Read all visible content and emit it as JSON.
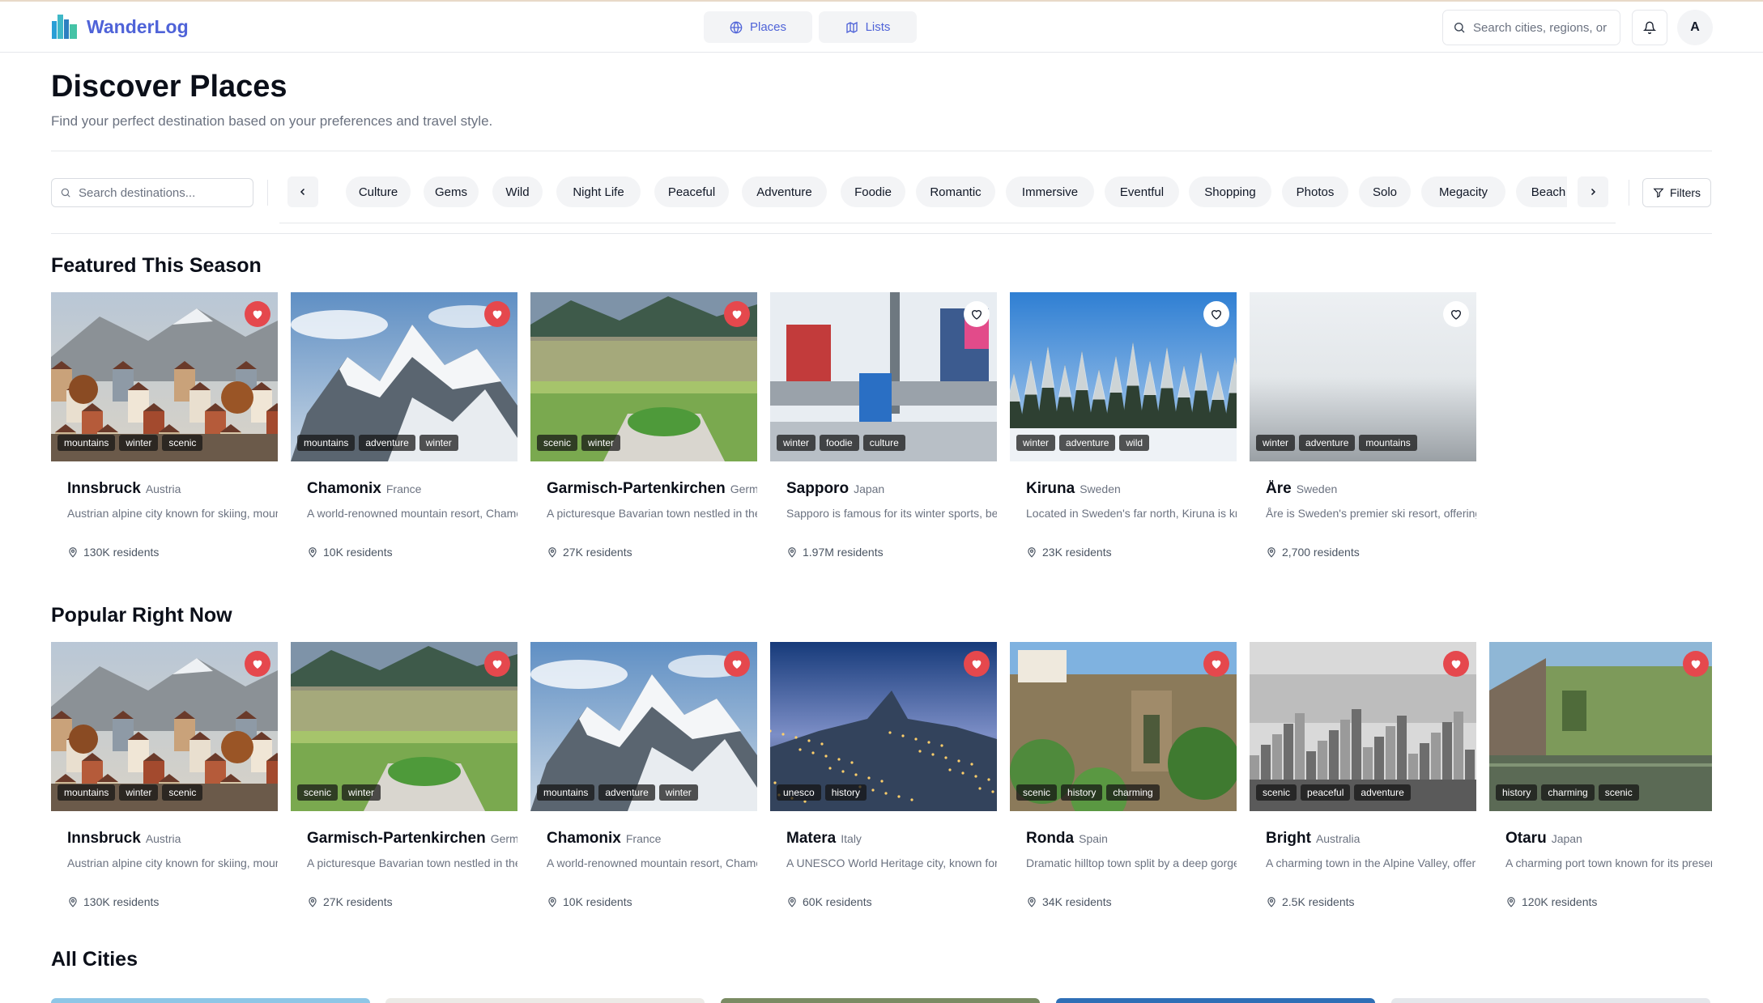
{
  "app": {
    "name": "WanderLog",
    "nav": [
      {
        "label": "Places",
        "icon": "globe-icon"
      },
      {
        "label": "Lists",
        "icon": "map-icon"
      }
    ],
    "search_placeholder": "Search cities, regions, or",
    "avatar_letter": "A"
  },
  "page": {
    "title": "Discover Places",
    "subtitle": "Find your perfect destination based on your preferences and travel style."
  },
  "filters": {
    "search_placeholder": "Search destinations...",
    "chips": [
      "Culture",
      "Gems",
      "Wild",
      "Night Life",
      "Peaceful",
      "Adventure",
      "Foodie",
      "Romantic",
      "Immersive",
      "Eventful",
      "Shopping",
      "Photos",
      "Solo",
      "Megacity",
      "Beach"
    ],
    "filters_label": "Filters",
    "prev_icon": "chevron-left-icon",
    "next_icon": "chevron-right-icon"
  },
  "colors": {
    "brand": "#4f63d8",
    "favorite_on": "#e5484d",
    "muted_text": "#6b7280",
    "chip_bg": "#f3f4f6"
  },
  "featured": {
    "title": "Featured This Season",
    "cards": [
      {
        "name": "Innsbruck",
        "country": "Austria",
        "desc": "Austrian alpine city known for skiing, mountains and historic old town",
        "pop": "130K residents",
        "tags": [
          "mountains",
          "winter",
          "scenic"
        ],
        "favorite": true,
        "image": "town"
      },
      {
        "name": "Chamonix",
        "country": "France",
        "desc": "A world-renowned mountain resort, Chamonix sits at the base of Mont Blanc",
        "pop": "10K residents",
        "tags": [
          "mountains",
          "adventure",
          "winter"
        ],
        "favorite": true,
        "image": "snowpeak"
      },
      {
        "name": "Garmisch-Partenkirchen",
        "country": "Germany",
        "desc": "A picturesque Bavarian town nestled in the Alps",
        "pop": "27K residents",
        "tags": [
          "scenic",
          "winter"
        ],
        "favorite": true,
        "image": "green"
      },
      {
        "name": "Sapporo",
        "country": "Japan",
        "desc": "Sapporo is famous for its winter sports, beer and ramen",
        "pop": "1.97M residents",
        "tags": [
          "winter",
          "foodie",
          "culture"
        ],
        "favorite": false,
        "image": "station"
      },
      {
        "name": "Kiruna",
        "country": "Sweden",
        "desc": "Located in Sweden's far north, Kiruna is known for the northern lights",
        "pop": "23K residents",
        "tags": [
          "winter",
          "adventure",
          "wild"
        ],
        "favorite": false,
        "image": "forest"
      },
      {
        "name": "Åre",
        "country": "Sweden",
        "desc": "Åre is Sweden's premier ski resort, offering slopes for everyone",
        "pop": "2,700 residents",
        "tags": [
          "winter",
          "adventure",
          "mountains"
        ],
        "favorite": false,
        "image": "fog"
      }
    ]
  },
  "popular": {
    "title": "Popular Right Now",
    "cards": [
      {
        "name": "Innsbruck",
        "country": "Austria",
        "desc": "Austrian alpine city known for skiing, mountains and historic old town",
        "pop": "130K residents",
        "tags": [
          "mountains",
          "winter",
          "scenic"
        ],
        "favorite": true,
        "image": "town"
      },
      {
        "name": "Garmisch-Partenkirchen",
        "country": "Germany",
        "desc": "A picturesque Bavarian town nestled in the Alps",
        "pop": "27K residents",
        "tags": [
          "scenic",
          "winter"
        ],
        "favorite": true,
        "image": "green"
      },
      {
        "name": "Chamonix",
        "country": "France",
        "desc": "A world-renowned mountain resort, Chamonix sits at the base of Mont Blanc",
        "pop": "10K residents",
        "tags": [
          "mountains",
          "adventure",
          "winter"
        ],
        "favorite": true,
        "image": "snowpeak"
      },
      {
        "name": "Matera",
        "country": "Italy",
        "desc": "A UNESCO World Heritage city, known for its ancient cave dwellings",
        "pop": "60K residents",
        "tags": [
          "unesco",
          "history"
        ],
        "favorite": true,
        "image": "night"
      },
      {
        "name": "Ronda",
        "country": "Spain",
        "desc": "Dramatic hilltop town split by a deep gorge",
        "pop": "34K residents",
        "tags": [
          "scenic",
          "history",
          "charming"
        ],
        "favorite": true,
        "image": "cliff"
      },
      {
        "name": "Bright",
        "country": "Australia",
        "desc": "A charming town in the Alpine Valley, offering outdoor adventures",
        "pop": "2.5K residents",
        "tags": [
          "scenic",
          "peaceful",
          "adventure"
        ],
        "favorite": true,
        "image": "grey"
      },
      {
        "name": "Otaru",
        "country": "Japan",
        "desc": "A charming port town known for its preserved canal",
        "pop": "120K residents",
        "tags": [
          "history",
          "charming",
          "scenic"
        ],
        "favorite": true,
        "image": "canal"
      }
    ]
  },
  "all_cities": {
    "title": "All Cities"
  }
}
